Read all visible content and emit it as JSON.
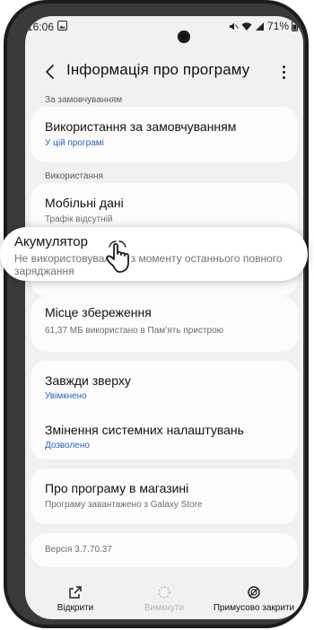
{
  "status_bar": {
    "time": "16:06",
    "battery": "71%"
  },
  "header": {
    "title": "Інформація про програму"
  },
  "partial_section": "За замовчуванням",
  "defaults_item": {
    "title": "Використання за замовчуванням",
    "subtitle": "У цій програмі"
  },
  "usage_section": "Використання",
  "mobile_data": {
    "title": "Мобільні дані",
    "subtitle": "Трафік відсутній"
  },
  "battery": {
    "title": "Акумулятор",
    "subtitle": "Не використовувалось з моменту останнього повного заряджання"
  },
  "storage": {
    "title": "Місце збереження",
    "subtitle": "61,37 МБ використано в Пам’ять пристрою"
  },
  "always_on_top": {
    "title": "Завжди зверху",
    "subtitle": "Увімкнено"
  },
  "system_settings": {
    "title": "Змінення системних налаштувань",
    "subtitle": "Дозволено"
  },
  "store": {
    "title": "Про програму в магазині",
    "subtitle": "Програму завантажено з Galaxy Store"
  },
  "version": "Версія 3.7.70.37",
  "bottom_bar": {
    "open": "Відкрити",
    "disable": "Вимкнути",
    "force_stop": "Примусово закрити"
  },
  "colors": {
    "accent": "#2b61c7",
    "screen_bg": "#f1f1f1",
    "card_bg": "#fcfcfc"
  }
}
